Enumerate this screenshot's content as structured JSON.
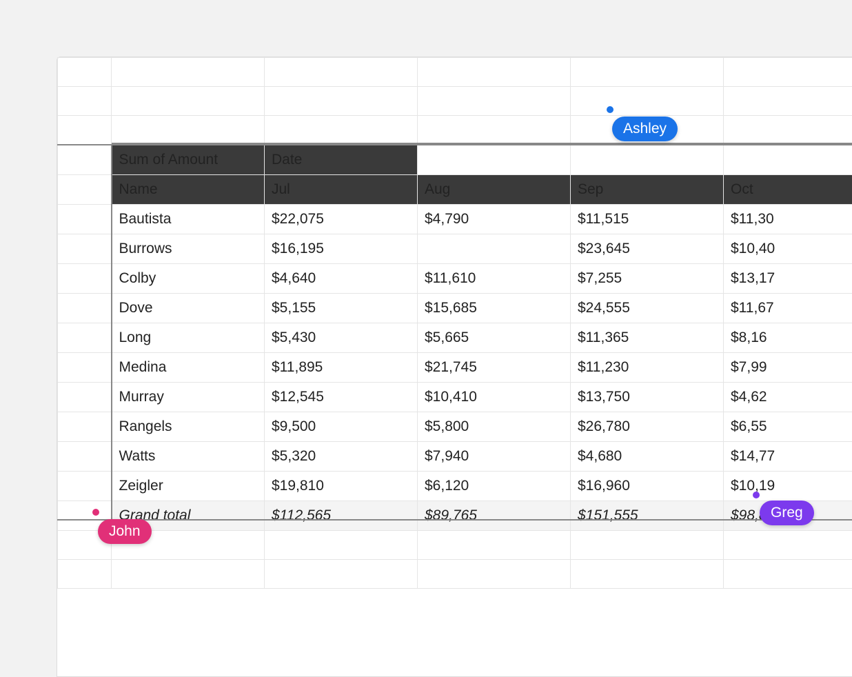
{
  "pivot": {
    "cornerLabel": "Sum of Amount",
    "dateLabel": "Date",
    "nameLabel": "Name",
    "months": [
      "Jul",
      "Aug",
      "Sep",
      "Oct"
    ],
    "rows": [
      {
        "name": "Bautista",
        "vals": [
          "$22,075",
          "$4,790",
          "$11,515",
          "$11,30"
        ]
      },
      {
        "name": "Burrows",
        "vals": [
          "$16,195",
          "",
          "$23,645",
          "$10,40"
        ]
      },
      {
        "name": "Colby",
        "vals": [
          "$4,640",
          "$11,610",
          "$7,255",
          "$13,17"
        ]
      },
      {
        "name": "Dove",
        "vals": [
          "$5,155",
          "$15,685",
          "$24,555",
          "$11,67"
        ]
      },
      {
        "name": "Long",
        "vals": [
          "$5,430",
          "$5,665",
          "$11,365",
          "$8,16"
        ]
      },
      {
        "name": "Medina",
        "vals": [
          "$11,895",
          "$21,745",
          "$11,230",
          "$7,99"
        ]
      },
      {
        "name": "Murray",
        "vals": [
          "$12,545",
          "$10,410",
          "$13,750",
          "$4,62"
        ]
      },
      {
        "name": "Rangels",
        "vals": [
          "$9,500",
          "$5,800",
          "$26,780",
          "$6,55"
        ]
      },
      {
        "name": "Watts",
        "vals": [
          "$5,320",
          "$7,940",
          "$4,680",
          "$14,77"
        ]
      },
      {
        "name": "Zeigler",
        "vals": [
          "$19,810",
          "$6,120",
          "$16,960",
          "$10,19"
        ]
      }
    ],
    "totalLabel": "Grand total",
    "totals": [
      "$112,565",
      "$89,765",
      "$151,555",
      "$98,84"
    ]
  },
  "collaborators": {
    "ashley": "Ashley",
    "john": "John",
    "greg": "Greg"
  }
}
